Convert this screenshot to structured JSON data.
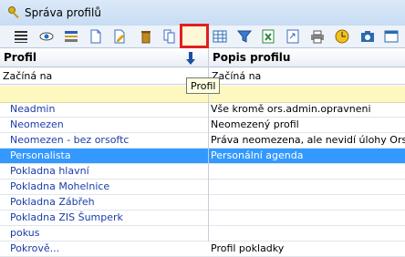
{
  "window": {
    "title": "Správa profilů",
    "icon": "key-icon"
  },
  "toolbar": {
    "buttons": [
      {
        "name": "list-icon"
      },
      {
        "name": "eye-icon"
      },
      {
        "name": "edit-icon"
      },
      {
        "name": "new-document-icon"
      },
      {
        "name": "edit-document-icon"
      },
      {
        "name": "trash-icon"
      },
      {
        "name": "copy-icon"
      },
      {
        "name": "checkmark-icon"
      },
      {
        "name": "grid-icon"
      },
      {
        "name": "filter-icon"
      },
      {
        "name": "excel-icon"
      },
      {
        "name": "refresh-icon"
      },
      {
        "name": "print-icon"
      },
      {
        "name": "clock-icon"
      },
      {
        "name": "camera-icon"
      },
      {
        "name": "window-icon"
      }
    ]
  },
  "table": {
    "columns": [
      {
        "label": "Profil",
        "filter_placeholder": "Začíná na"
      },
      {
        "label": "Popis profilu",
        "filter_placeholder": "Začíná na"
      }
    ],
    "rows": [
      {
        "profil": "Neadmin",
        "popis": "Vše kromě ors.admin.opravneni",
        "selected": false
      },
      {
        "profil": "Neomezen",
        "popis": "Neomezený profil",
        "selected": false
      },
      {
        "profil": "Neomezen - bez orsoftc",
        "popis": "Práva neomezena, ale nevidí úlohy Orsoftu (",
        "selected": false
      },
      {
        "profil": "Personalista",
        "popis": "Personální agenda",
        "selected": true
      },
      {
        "profil": "Pokladna hlavní",
        "popis": "",
        "selected": false
      },
      {
        "profil": "Pokladna Mohelnice",
        "popis": "",
        "selected": false
      },
      {
        "profil": "Pokladna Zábřeh",
        "popis": "",
        "selected": false
      },
      {
        "profil": "Pokladna ZIS Šumperk",
        "popis": "",
        "selected": false
      },
      {
        "profil": "pokus",
        "popis": "",
        "selected": false
      },
      {
        "profil": "Pokrově...",
        "popis": "Profil pokladky",
        "selected": false
      }
    ]
  },
  "tooltip": {
    "text": "Profil"
  },
  "colors": {
    "selected": "#3399ff",
    "highlight_border": "#e02020",
    "empty_row": "#fdf7c0"
  }
}
